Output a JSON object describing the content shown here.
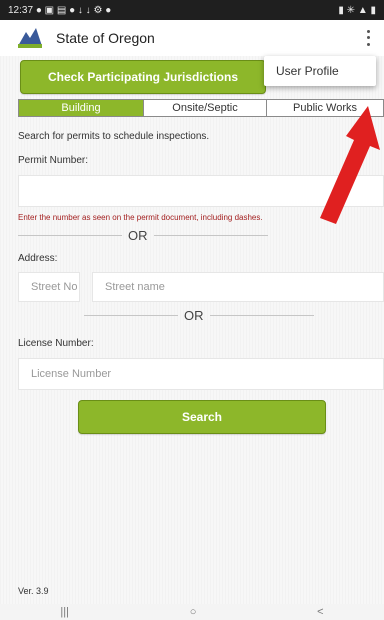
{
  "status_bar": {
    "time": "12:37",
    "left_icons": "● ▣ ▤ ● ↓ ↓ ⚙ ●",
    "right_icons": "▮ ✳ ▲ ▮"
  },
  "app_bar": {
    "title": "State of Oregon",
    "logo_icon": "oregon-logo-icon",
    "menu_icon": "more-vert-icon"
  },
  "menu": {
    "user_profile_label": "User Profile"
  },
  "actions": {
    "check_jurisdictions_label": "Check Participating Jurisdictions",
    "search_label": "Search"
  },
  "tabs": [
    {
      "label": "Building",
      "active": true
    },
    {
      "label": "Onsite/Septic",
      "active": false
    },
    {
      "label": "Public Works",
      "active": false
    }
  ],
  "form": {
    "intro_text": "Search for permits to schedule inspections.",
    "permit_label": "Permit Number:",
    "permit_value": "",
    "permit_hint": "Enter the number as seen on the permit document, including dashes.",
    "or_text": "OR",
    "address_label": "Address:",
    "street_no_placeholder": "Street No",
    "street_name_placeholder": "Street name",
    "license_label": "License Number:",
    "license_placeholder": "License Number"
  },
  "version": "Ver. 3.9",
  "nav": {
    "recents_icon": "|||",
    "home_icon": "○",
    "back_icon": "<"
  },
  "colors": {
    "accent_green": "#8db72a",
    "hint_red": "#a31f1f",
    "annotation_arrow": "#e02020"
  }
}
